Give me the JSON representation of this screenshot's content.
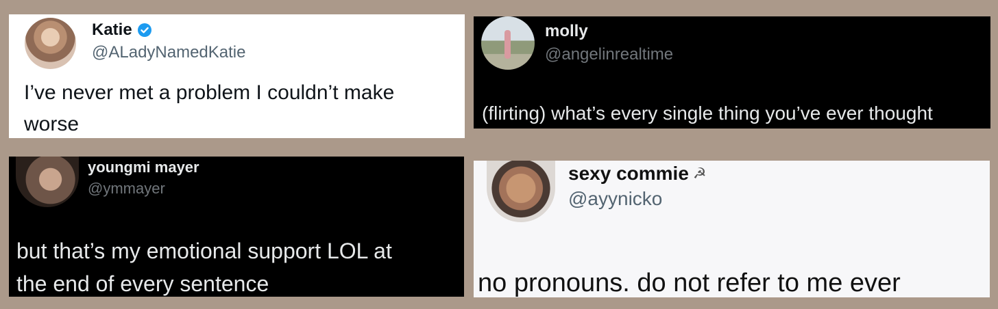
{
  "tweets": [
    {
      "name": "Katie",
      "verified": true,
      "handle": "@ALadyNamedKatie",
      "text_lines": [
        "I’ve never met a problem I couldn’t make",
        "worse"
      ],
      "theme": "light",
      "verified_color": "#1d9bf0"
    },
    {
      "name": "molly",
      "handle": "@angelinrealtime",
      "text_lines": [
        "(flirting) what’s every single thing you’ve ever thought"
      ],
      "theme": "dark"
    },
    {
      "name": "youngmi mayer",
      "handle": "@ymmayer",
      "text_lines": [
        "but that’s my emotional support LOL at",
        "the end of every sentence"
      ],
      "theme": "dark"
    },
    {
      "name": "sexy commie",
      "name_emoji": "☭",
      "handle": "@ayynicko",
      "text_lines": [
        "no pronouns. do not refer to me ever"
      ],
      "theme": "light"
    }
  ],
  "colors": {
    "background": "#ab998a",
    "verified_blue": "#1d9bf0"
  }
}
